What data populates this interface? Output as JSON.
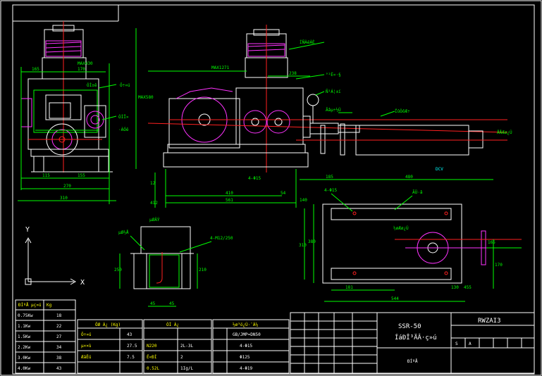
{
  "drawing": {
    "title_block": {
      "model": "SSR-50",
      "name_garbled": "ÍáÐÎ³ÄÂ·ç»ú",
      "drawing_no": "RWZAI3",
      "sheet_label": "S",
      "sheet_label2": "A",
      "footer": "ÐÍºÅ"
    },
    "weight_table": {
      "header_left": "ÐÍºÅ",
      "header_mid": "µç»ú",
      "header_right": "Kg",
      "rows": [
        {
          "power": "0.75Kw",
          "weight": "18"
        },
        {
          "power": "1.1Kw",
          "weight": "22"
        },
        {
          "power": "1.5Kw",
          "weight": "27"
        },
        {
          "power": "2.2Kw",
          "weight": "34"
        },
        {
          "power": "3.0Kw",
          "weight": "38"
        },
        {
          "power": "4.0Kw",
          "weight": "43"
        }
      ]
    },
    "spec_table_1": {
      "header": "ÖØ Á¿ (Kg)",
      "rows": [
        {
          "label": "Ö÷»ú",
          "value": "43"
        },
        {
          "label": "µ××ù",
          "value": "27.5"
        },
        {
          "label": "ÆäËü",
          "value": "7.5"
        }
      ]
    },
    "spec_table_2": {
      "header": "ÓÍ Á¿",
      "rows": [
        {
          "left": "N220",
          "right": "2L-3L"
        },
        {
          "left": "Ë«ÐÍ",
          "right": "2"
        },
        {
          "left": "0.52L",
          "right": "1Ig/L"
        }
      ]
    },
    "spec_table_3": {
      "header": "½ø³ö¿Ú·¨À¼",
      "rows": [
        {
          "left": "",
          "right": "GB/JMP=DN50"
        },
        {
          "left": "",
          "right": "4-Φ15"
        },
        {
          "left": "",
          "right": "Φ125"
        },
        {
          "left": "",
          "right": "4-Φ19"
        }
      ]
    },
    "dimensions": {
      "front_165": "165",
      "front_170": "170",
      "front_115": "115",
      "front_155": "155",
      "front_270": "270",
      "front_310": "310",
      "front_max": "MAX430",
      "side_max_width": "MAX1271",
      "side_max_height": "MAX580",
      "side_238": "238",
      "side_410": "410",
      "side_561": "561",
      "side_140": "140",
      "side_54": "54",
      "side_4_phi15": "4-Φ15",
      "side_185": "185",
      "side_480": "480",
      "side_412": "412",
      "side_12": "12",
      "plan_4_phi15": "4-Φ15",
      "plan_310": "310",
      "plan_380": "380",
      "plan_181": "181",
      "plan_544": "544",
      "plan_455": "455",
      "plan_130": "130",
      "plan_170": "170",
      "plan_165": "165",
      "section_4_m12": "4-M12/250",
      "section_250": "250",
      "section_210": "210",
      "section_45": "45",
      "section_45b": "45",
      "dcv_label": "DCV"
    },
    "axis": {
      "y": "Y",
      "x": "X"
    },
    "callouts": {
      "top_right_1": "ÍÑÀëÀÈ",
      "top_right_2": "°²È«·§",
      "top_right_3": "Ñ¹Á¦±í",
      "top_right_4": "Ãâµ÷½Ú",
      "left_1": "ÓÍ±ê",
      "left_2": "Ö÷»ú",
      "left_3": "ÓÍÏ»",
      "left_4": "·ÀÓê",
      "pipe_label": "ÏûÒôÆ÷",
      "outlet_label": "ÅÅÆø¿Ú",
      "inlet_label": "½øÆø¿Ú",
      "section_label": "µØ½Å",
      "section_label2": "µØÂÝ",
      "plan_label": "ÃÜ·â"
    }
  }
}
